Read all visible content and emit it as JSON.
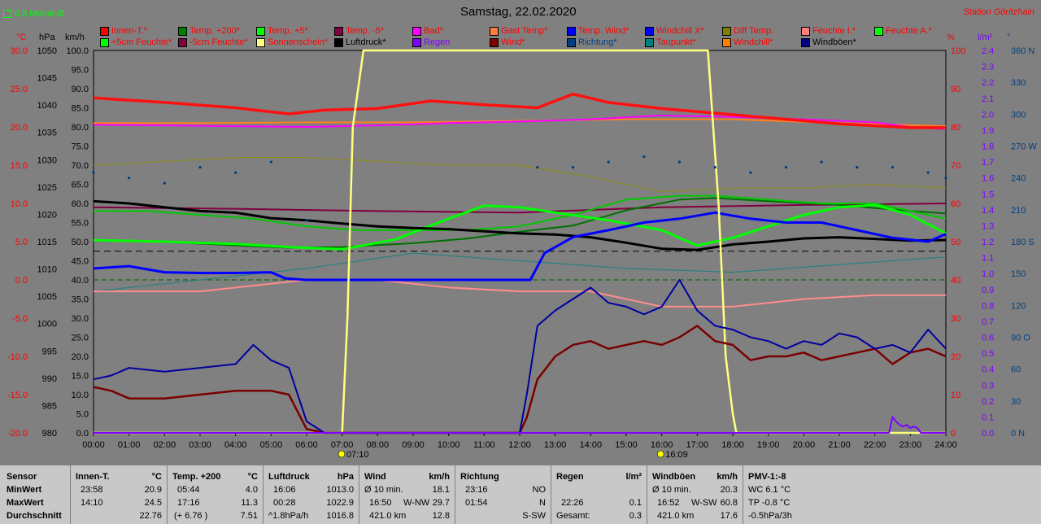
{
  "header": {
    "title": "Samstag, 22.02.2020",
    "station": "Station Göritzhain",
    "monthly_avg_label": "0.8 Monat-Ø"
  },
  "colors": {
    "background": "#808080",
    "inside_temp": "#ff1010",
    "temp_200": "#008000",
    "temp_5": "#00ff00",
    "temp_minus5": "#800040",
    "bath": "#ff00ff",
    "guest_temp": "#ff8020",
    "temp_wind": "#0000ff",
    "windchill_x": "#0000ff",
    "diff_temp": "#808000",
    "humidity_inside": "#ff8080",
    "humidity_outside": "#00ff00",
    "feuchte_5": "#00ff00",
    "feuchte_minus5": "#800040",
    "sunshine": "#ffff80",
    "pressure": "#000000",
    "rain": "#8000ff",
    "wind": "#800000",
    "direction": "#004080",
    "dewpoint": "#008080",
    "windchill": "#ff8000",
    "gusts": "#000080"
  },
  "legend": [
    {
      "label": "Innen-T.*",
      "color": "#ff0000",
      "text_color": "#ff0000"
    },
    {
      "label": "Temp. +200*",
      "color": "#008000",
      "text_color": "#ff0000"
    },
    {
      "label": "Temp. +5*",
      "color": "#00ff00",
      "text_color": "#ff0000"
    },
    {
      "label": "Temp. -5*",
      "color": "#800040",
      "text_color": "#ff0000"
    },
    {
      "label": "Bad*",
      "color": "#ff00ff",
      "text_color": "#ff0000"
    },
    {
      "label": "Gast Temp*",
      "color": "#ff8040",
      "text_color": "#ff0000"
    },
    {
      "label": "Temp. Wind*",
      "color": "#0000ff",
      "text_color": "#ff0000"
    },
    {
      "label": "Windchill X*",
      "color": "#0000ff",
      "text_color": "#ff0000"
    },
    {
      "label": "Diff Temp.",
      "color": "#808000",
      "text_color": "#ff0000"
    },
    {
      "label": "Feuchte I.*",
      "color": "#ff8080",
      "text_color": "#ff0000"
    },
    {
      "label": "Feuchte A.*",
      "color": "#00ff00",
      "text_color": "#ff0000"
    },
    {
      "label": "+5cm Feuchte*",
      "color": "#00ff00",
      "text_color": "#ff0000"
    },
    {
      "label": "-5cm Feuchte*",
      "color": "#800040",
      "text_color": "#ff0000"
    },
    {
      "label": "Sonnenschein*",
      "color": "#ffff80",
      "text_color": "#ff0000"
    },
    {
      "label": "Luftdruck*",
      "color": "#000000",
      "text_color": "#000000"
    },
    {
      "label": "Regen",
      "color": "#8000ff",
      "text_color": "#8000ff"
    },
    {
      "label": "Wind*",
      "color": "#800000",
      "text_color": "#ff0000"
    },
    {
      "label": "Richtung*",
      "color": "#004080",
      "text_color": "#004080"
    },
    {
      "label": "Taupunkt*",
      "color": "#008080",
      "text_color": "#ff0000"
    },
    {
      "label": "Windchill*",
      "color": "#ff8000",
      "text_color": "#ff0000"
    },
    {
      "label": "Windböen*",
      "color": "#000080",
      "text_color": "#000000"
    }
  ],
  "axes": {
    "temp": {
      "unit": "°C",
      "ticks": [
        "30.0",
        "25.0",
        "20.0",
        "15.0",
        "10.0",
        "5.0",
        "0.0",
        "-5.0",
        "-10.0",
        "-15.0",
        "-20.0"
      ]
    },
    "pressure": {
      "unit": "hPa",
      "ticks": [
        "1050",
        "1045",
        "1040",
        "1035",
        "1030",
        "1025",
        "1020",
        "1015",
        "1010",
        "1005",
        "1000",
        "995",
        "990",
        "985",
        "980"
      ]
    },
    "wind": {
      "unit": "km/h",
      "ticks": [
        "100.0",
        "95.0",
        "90.0",
        "85.0",
        "80.0",
        "75.0",
        "70.0",
        "65.0",
        "60.0",
        "55.0",
        "50.0",
        "45.0",
        "40.0",
        "35.0",
        "30.0",
        "25.0",
        "20.0",
        "15.0",
        "10.0",
        "5.0",
        "0.0"
      ]
    },
    "humidity": {
      "unit": "%",
      "ticks": [
        "100",
        "90",
        "80",
        "70",
        "60",
        "50",
        "40",
        "30",
        "20",
        "10",
        "0"
      ]
    },
    "rain": {
      "unit": "l/m²",
      "ticks": [
        "2.4",
        "2.3",
        "2.2",
        "2.1",
        "2.0",
        "1.9",
        "1.8",
        "1.7",
        "1.6",
        "1.5",
        "1.4",
        "1.3",
        "1.2",
        "1.1",
        "1.0",
        "0.9",
        "0.8",
        "0.7",
        "0.6",
        "0.5",
        "0.4",
        "0.3",
        "0.2",
        "0.1",
        "0.0"
      ]
    },
    "direction": {
      "unit": "°",
      "ticks": [
        "360 N",
        "330",
        "300",
        "270 W",
        "240",
        "210",
        "180 S",
        "150",
        "120",
        "90 O",
        "60",
        "30",
        "0 N"
      ]
    },
    "time_ticks": [
      "00:00",
      "01:00",
      "02:00",
      "03:00",
      "04:00",
      "05:00",
      "06:00",
      "07:00",
      "08:00",
      "09:00",
      "10:00",
      "11:00",
      "12:00",
      "13:00",
      "14:00",
      "15:00",
      "16:00",
      "17:00",
      "18:00",
      "19:00",
      "20:00",
      "21:00",
      "22:00",
      "23:00",
      "24:00"
    ],
    "sunrise": "07:10",
    "sunset": "16:09"
  },
  "chart_data": {
    "type": "line",
    "title": "Samstag, 22.02.2020",
    "x_range": [
      "00:00",
      "24:00"
    ],
    "temp_range": [
      -20,
      30
    ],
    "pressure_range": [
      980,
      1050
    ],
    "wind_range": [
      0,
      100
    ],
    "humidity_range": [
      0,
      100
    ],
    "rain_range": [
      0,
      2.4
    ],
    "series": [
      {
        "name": "Innen-T.*",
        "axis": "temp",
        "x": [
          0,
          2,
          4,
          5.5,
          6.5,
          8,
          9.5,
          11,
          12.5,
          13.5,
          14.5,
          16,
          17.5,
          19,
          21,
          23,
          24
        ],
        "values": [
          23.8,
          23.2,
          22.5,
          21.7,
          22.2,
          22.4,
          23.4,
          22.9,
          22.5,
          24.3,
          23.2,
          22.4,
          21.8,
          21.2,
          20.4,
          19.9,
          19.9
        ]
      },
      {
        "name": "Bad*",
        "axis": "temp",
        "x": [
          0,
          2,
          4,
          6,
          8,
          10,
          12,
          14,
          16,
          18,
          20,
          22,
          23,
          24
        ],
        "values": [
          20.3,
          20.2,
          20.1,
          20.0,
          20.2,
          20.5,
          20.7,
          21.0,
          21.5,
          21.3,
          21.0,
          20.6,
          20.0,
          19.7
        ]
      },
      {
        "name": "Gast Temp*",
        "axis": "temp",
        "x": [
          0,
          3,
          6,
          9,
          12,
          15,
          18,
          21,
          24
        ],
        "values": [
          20.5,
          20.5,
          20.6,
          20.6,
          20.8,
          21.0,
          21.0,
          20.5,
          20.1
        ]
      },
      {
        "name": "Temp. +200*",
        "axis": "temp",
        "x": [
          0,
          2,
          4,
          5.5,
          7,
          9,
          10.5,
          12,
          13.5,
          15,
          16.5,
          17.5,
          19,
          21,
          23,
          24
        ],
        "values": [
          5.2,
          5.0,
          4.5,
          4.2,
          4.3,
          4.8,
          5.4,
          6.3,
          7.1,
          9.1,
          10.5,
          10.7,
          10.3,
          9.8,
          9.0,
          8.7
        ]
      },
      {
        "name": "Temp. +5*",
        "axis": "temp",
        "x": [
          0,
          2,
          4,
          5.5,
          7,
          8.5,
          10,
          11,
          12,
          13,
          14.5,
          16,
          17,
          18,
          19,
          20,
          21,
          22,
          23,
          24
        ],
        "values": [
          5.2,
          5.0,
          4.7,
          4.3,
          4.0,
          5.3,
          8.0,
          9.7,
          9.5,
          8.8,
          7.8,
          6.5,
          4.5,
          5.5,
          7.0,
          8.5,
          9.5,
          9.8,
          8.5,
          6.1
        ]
      },
      {
        "name": "Temp. -5*",
        "axis": "temp",
        "x": [
          0,
          4,
          8,
          12,
          16,
          20,
          24
        ],
        "values": [
          9.5,
          9.3,
          9.0,
          8.8,
          9.5,
          9.8,
          10.0
        ]
      },
      {
        "name": "Luftdruck*",
        "axis": "pressure",
        "x": [
          0,
          1,
          2,
          3,
          4,
          5,
          6,
          7,
          8,
          9,
          10,
          11,
          12,
          13,
          14,
          15,
          16,
          17,
          18,
          19,
          20,
          21,
          22,
          23,
          24
        ],
        "values": [
          1022.4,
          1022.0,
          1021.3,
          1020.6,
          1020.3,
          1019.3,
          1018.9,
          1018.3,
          1017.8,
          1017.5,
          1017.3,
          1016.9,
          1016.5,
          1016.3,
          1015.8,
          1014.8,
          1013.7,
          1013.5,
          1014.5,
          1015.0,
          1015.6,
          1015.8,
          1015.5,
          1015.2,
          1015.3
        ]
      },
      {
        "name": "Feuchte I.*",
        "axis": "humidity",
        "x": [
          0,
          3,
          6,
          8,
          10,
          12,
          14,
          16,
          18,
          20,
          22,
          24
        ],
        "values": [
          37,
          37,
          40,
          40,
          38,
          37,
          37,
          33,
          33,
          35,
          36,
          36
        ]
      },
      {
        "name": "Feuchte A.*",
        "axis": "humidity",
        "x": [
          0,
          1.5,
          3,
          4.5,
          6,
          7.5,
          9,
          10.5,
          12,
          13.5,
          15,
          16.5,
          17.5,
          19,
          20.5,
          22,
          23,
          24
        ],
        "values": [
          58,
          58,
          57,
          56,
          54,
          53,
          53,
          53,
          54,
          57,
          61,
          62,
          62,
          61,
          60,
          60,
          58,
          56
        ]
      },
      {
        "name": "Taupunkt*",
        "axis": "humidity",
        "x": [
          0,
          3,
          6,
          9,
          12,
          15,
          18,
          21,
          24
        ],
        "values": [
          37,
          40,
          43,
          47,
          45,
          43,
          42,
          44,
          46
        ]
      },
      {
        "name": "Diff Temp.",
        "axis": "humidity",
        "x": [
          0,
          2,
          4,
          6,
          8,
          10,
          12,
          14,
          16,
          18,
          20,
          22,
          24
        ],
        "values": [
          70,
          71,
          72,
          72,
          71,
          70,
          70,
          67,
          63,
          64,
          64,
          65,
          64
        ]
      },
      {
        "name": "Temp. Wind*",
        "axis": "temp",
        "x": [
          0,
          1,
          2,
          3,
          4,
          5,
          5.4,
          6,
          7,
          8,
          9,
          10,
          11,
          12,
          12.3,
          12.7,
          13.5,
          14.5,
          15.5,
          16.5,
          17.5,
          18.5,
          19.5,
          20.5,
          21.5,
          22.5,
          23.5,
          24
        ],
        "values": [
          1.5,
          1.8,
          1.0,
          0.9,
          0.9,
          1.0,
          0.2,
          0.0,
          0.0,
          0.0,
          0.0,
          0.0,
          0.0,
          0.0,
          0.0,
          3.5,
          5.6,
          6.5,
          7.5,
          8.0,
          8.8,
          8.0,
          7.5,
          7.5,
          6.5,
          5.5,
          5.0,
          6.0
        ]
      },
      {
        "name": "Sonnenschein*",
        "axis": "wind",
        "x": [
          0,
          7.0,
          7.15,
          7.3,
          7.6,
          8,
          17.3,
          17.6,
          17.8,
          18.0,
          18.1,
          24
        ],
        "values": [
          0,
          0,
          30,
          80,
          100,
          100,
          100,
          60,
          20,
          5,
          0,
          0
        ]
      },
      {
        "name": "Wind*",
        "axis": "wind",
        "x": [
          0,
          0.5,
          1,
          2,
          3,
          4,
          5,
          5.5,
          6,
          6.5,
          12,
          12.2,
          12.5,
          13,
          13.5,
          14,
          14.5,
          15,
          15.5,
          16,
          16.5,
          17,
          17.5,
          18,
          18.5,
          19,
          19.5,
          20,
          20.5,
          21,
          21.5,
          22,
          22.5,
          23,
          23.5,
          24
        ],
        "values": [
          12,
          11,
          9,
          9,
          10,
          11,
          11,
          10,
          1,
          0,
          0,
          4,
          14,
          20,
          23,
          24,
          22,
          23,
          24,
          23,
          25,
          28,
          24,
          23,
          19,
          20,
          20,
          21,
          19,
          20,
          21,
          22,
          18,
          21,
          22,
          20
        ]
      },
      {
        "name": "Windböen*",
        "axis": "wind",
        "x": [
          0,
          0.5,
          1,
          2,
          3,
          4,
          4.5,
          5,
          5.5,
          6,
          6.5,
          12,
          12.2,
          12.5,
          13,
          13.5,
          14,
          14.5,
          15,
          15.5,
          16,
          16.5,
          17,
          17.5,
          18,
          18.5,
          19,
          19.5,
          20,
          20.5,
          21,
          21.5,
          22,
          22.5,
          23,
          23.5,
          24
        ],
        "values": [
          14,
          15,
          17,
          16,
          17,
          18,
          23,
          19,
          17,
          3,
          0,
          0,
          10,
          28,
          32,
          35,
          38,
          34,
          33,
          31,
          33,
          40,
          32,
          28,
          27,
          25,
          24,
          22,
          24,
          23,
          26,
          25,
          22,
          23,
          21,
          27,
          22
        ]
      },
      {
        "name": "Richtung*",
        "axis": "direction",
        "x": [
          0,
          1,
          2,
          3,
          4,
          5,
          6,
          12.5,
          13.5,
          14.5,
          15.5,
          16.5,
          17.5,
          18.5,
          19.5,
          20.5,
          21.5,
          22.5,
          23.5,
          24
        ],
        "values": [
          245,
          240,
          235,
          250,
          245,
          255,
          200,
          250,
          250,
          255,
          260,
          255,
          250,
          245,
          250,
          255,
          250,
          250,
          245,
          240
        ]
      },
      {
        "name": "Regen",
        "axis": "rain",
        "x": [
          0,
          22.4,
          22.5,
          22.6,
          22.7,
          22.8,
          22.9,
          23.0,
          23.1,
          23.2,
          23.3,
          24
        ],
        "values": [
          0,
          0,
          0.1,
          0.07,
          0.05,
          0.04,
          0.05,
          0.03,
          0.04,
          0.03,
          0,
          0
        ]
      }
    ]
  },
  "footer": {
    "sensor": {
      "header": "Sensor",
      "min": "MinWert",
      "max": "MaxWert",
      "avg": "Durchschnitt"
    },
    "innen": {
      "header": "Innen-T.",
      "unit": "°C",
      "min_time": "23:58",
      "min_val": "20.9",
      "max_time": "14:10",
      "max_val": "24.5",
      "avg_val": "22.76"
    },
    "temp200": {
      "header": "Temp. +200",
      "unit": "°C",
      "min_time": "05:44",
      "min_val": "4.0",
      "max_time": "17:16",
      "max_val": "11.3",
      "avg_extra": "(+ 6.76 )",
      "avg_val": "7.51"
    },
    "pressure": {
      "header": "Luftdruck",
      "unit": "hPa",
      "min_time": "16:06",
      "min_val": "1013.0",
      "max_time": "00:28",
      "max_val": "1022.9",
      "avg_extra": "^1.8hPa/h",
      "avg_val": "1016.8"
    },
    "wind": {
      "header": "Wind",
      "unit": "km/h",
      "row1_label": "Ø 10 min.",
      "row1_val": "18.1",
      "row2_time": "16:50",
      "row2_dir": "W-NW",
      "row2_val": "29.7",
      "row3_label": "421.0 km",
      "row3_val": "12.8"
    },
    "direction": {
      "header": "Richtung",
      "row1_time": "23:16",
      "row1_val": "NO",
      "row2_time": "01:54",
      "row2_val": "N",
      "row3_val": "S-SW"
    },
    "rain": {
      "header": "Regen",
      "unit": "l/m²",
      "row2_time": "22:26",
      "row2_val": "0.1",
      "row3_label": "Gesamt:",
      "row3_val": "0.3"
    },
    "gusts": {
      "header": "Windböen",
      "unit": "km/h",
      "row1_label": "Ø 10 min.",
      "row1_val": "20.3",
      "row2_time": "16:52",
      "row2_dir": "W-SW",
      "row2_val": "60.8",
      "row3_label": "421.0 km",
      "row3_val": "17.6"
    },
    "pmv": {
      "header": "PMV-1:-8",
      "row1": "WC 6.1 °C",
      "row2": "TP -0.8 °C",
      "row3": "-0.5hPa/3h"
    }
  }
}
